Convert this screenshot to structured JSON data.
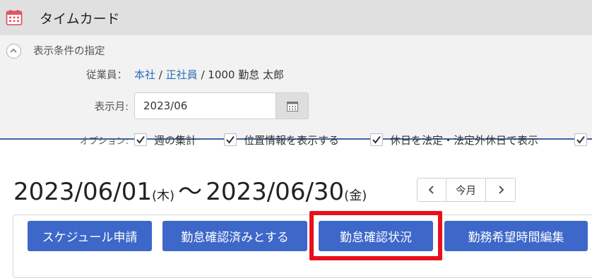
{
  "app": {
    "title": "タイムカード",
    "icon": "calendar-icon"
  },
  "filter": {
    "section_label": "表示条件の指定",
    "employee": {
      "label": "従業員：",
      "company": "本社",
      "sep1": "/",
      "type": "正社員",
      "sep2": "/",
      "name": "1000 勤怠 太郎"
    },
    "month": {
      "label": "表示月:",
      "value": "2023/06"
    },
    "options": {
      "label": "オプション:",
      "items": [
        {
          "label": "週の集計",
          "checked": true
        },
        {
          "label": "位置情報を表示する",
          "checked": true
        },
        {
          "label": "休日を法定・法定外休日で表示",
          "checked": true
        },
        {
          "label": "",
          "checked": true
        }
      ]
    }
  },
  "range": {
    "start": "2023/06/01",
    "start_dow": "(木)",
    "tilde": "〜",
    "end": "2023/06/30",
    "end_dow": "(金)"
  },
  "nav": {
    "prev": "‹",
    "today": "今月",
    "next": "›"
  },
  "actions": {
    "buttons": [
      {
        "label": "スケジュール申請"
      },
      {
        "label": "勤怠確認済みとする"
      },
      {
        "label": "勤怠確認状況",
        "highlighted": true
      },
      {
        "label": "勤務希望時間編集"
      }
    ]
  },
  "colors": {
    "primary_button": "#3d67c9",
    "link": "#2f6fb8",
    "highlight_border": "#e8101a",
    "titlebar_bg": "#e0e0e0",
    "filter_bg": "#f2f2f2"
  }
}
